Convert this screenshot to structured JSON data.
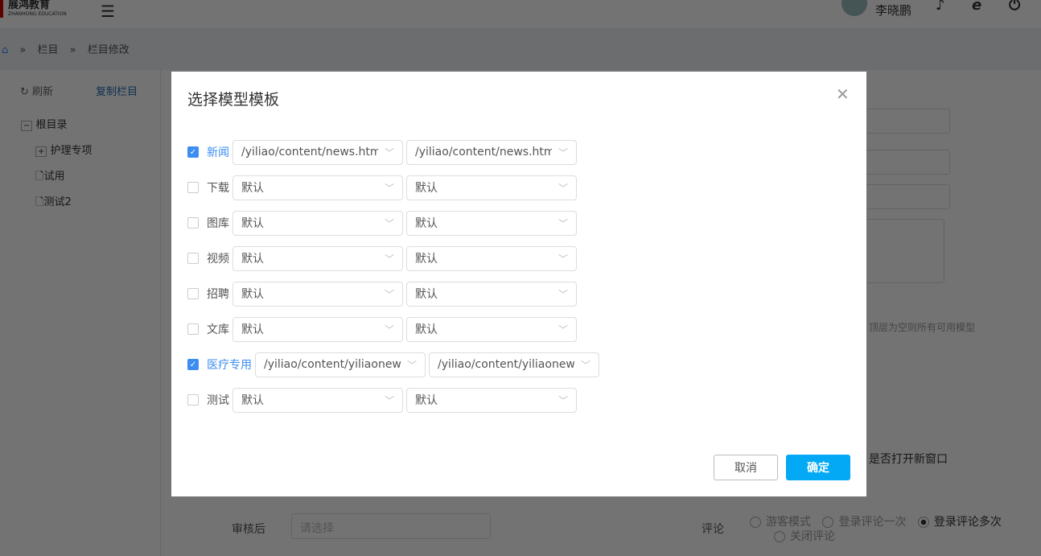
{
  "header": {
    "logo": "展鸿教育",
    "logo_sub": "ZHANHONG EDUCATION",
    "user": "李晓鹏"
  },
  "breadcrumb": [
    "栏目",
    "栏目修改"
  ],
  "sidebar": {
    "refresh": "刷新",
    "copy": "复制栏目",
    "tree": [
      {
        "label": "根目录",
        "type": "minus"
      },
      {
        "label": "护理专项",
        "type": "plus"
      },
      {
        "label": "试用",
        "type": "file"
      },
      {
        "label": "测试2",
        "type": "file"
      }
    ]
  },
  "background": {
    "hint": "顶层为空则所有可用模型",
    "new_window": "是否打开新窗口",
    "review_label": "审核后",
    "review_placeholder": "请选择",
    "comment_label": "评论",
    "comment_options": [
      "游客模式",
      "登录评论一次",
      "登录评论多次",
      "关闭评论"
    ],
    "comment_selected": "登录评论多次"
  },
  "modal": {
    "title": "选择模型模板",
    "rows": [
      {
        "label": "新闻",
        "checked": true,
        "tpl1": "/yiliao/content/news.html",
        "tpl2": "/yiliao/content/news.html"
      },
      {
        "label": "下载",
        "checked": false,
        "tpl1": "默认",
        "tpl2": "默认"
      },
      {
        "label": "图库",
        "checked": false,
        "tpl1": "默认",
        "tpl2": "默认"
      },
      {
        "label": "视频",
        "checked": false,
        "tpl1": "默认",
        "tpl2": "默认"
      },
      {
        "label": "招聘",
        "checked": false,
        "tpl1": "默认",
        "tpl2": "默认"
      },
      {
        "label": "文库",
        "checked": false,
        "tpl1": "默认",
        "tpl2": "默认"
      },
      {
        "label": "医疗专用",
        "checked": true,
        "tpl1": "/yiliao/content/yiliaonews_n",
        "tpl2": "/yiliao/content/yiliaonews_n"
      },
      {
        "label": "测试",
        "checked": false,
        "tpl1": "默认",
        "tpl2": "默认"
      }
    ],
    "cancel": "取消",
    "ok": "确定"
  },
  "colors": {
    "accent": "#03a9f4",
    "checkbox": "#3b8ef0"
  }
}
